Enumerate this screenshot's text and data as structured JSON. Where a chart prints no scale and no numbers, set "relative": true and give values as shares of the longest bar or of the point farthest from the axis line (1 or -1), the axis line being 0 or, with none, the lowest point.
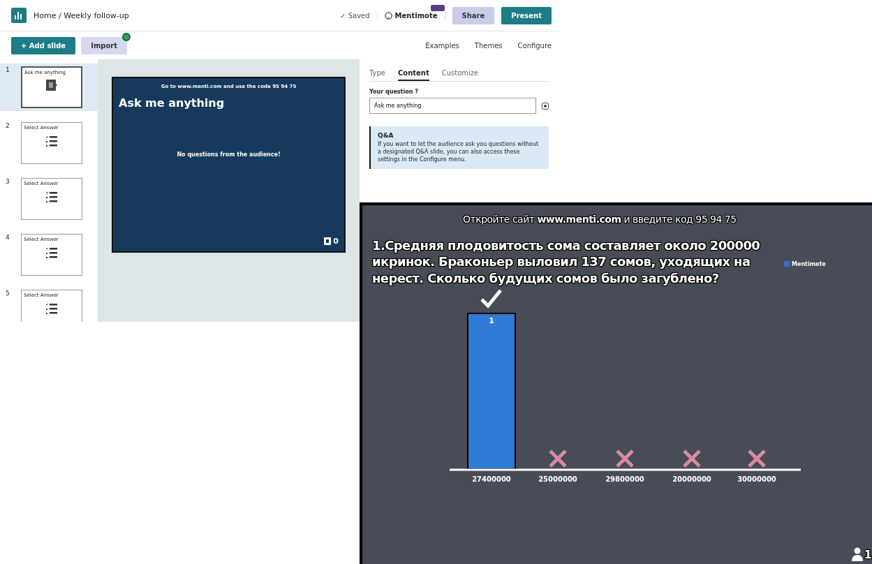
{
  "editor": {
    "breadcrumb": "Home / Weekly follow-up",
    "saved": "✓ Saved",
    "help_label": "Mentimote",
    "share": "Share",
    "present": "Present",
    "add_slide": "+ Add slide",
    "import": "Import",
    "toolbar_links": [
      "Examples",
      "Themes",
      "Configure"
    ],
    "slides": [
      {
        "number": "1",
        "title": "Ask me anything",
        "kind": "qa",
        "selected": true
      },
      {
        "number": "2",
        "title": "Select Answer",
        "kind": "choice",
        "selected": false
      },
      {
        "number": "3",
        "title": "Select Answer",
        "kind": "choice",
        "selected": false
      },
      {
        "number": "4",
        "title": "Select Answer",
        "kind": "choice",
        "selected": false
      },
      {
        "number": "5",
        "title": "Select Answer",
        "kind": "choice",
        "selected": false
      }
    ],
    "preview": {
      "join_text": "Go to www.menti.com and use the code 95 94 75",
      "title": "Ask me anything",
      "empty_text": "No questions from the audience!",
      "count": "0"
    },
    "tabs": [
      {
        "label": "Type",
        "selected": false
      },
      {
        "label": "Content",
        "selected": true
      },
      {
        "label": "Customize",
        "selected": false
      }
    ],
    "question_label": "Your question ?",
    "question_value": "Ask me anything",
    "info": {
      "title": "Q&A",
      "text": "If you want to let the audience ask you questions without a designated Q&A slide, you can also access these settings in the Configure menu."
    }
  },
  "presentation": {
    "join_text": "Откройте сайт **www.menti.com** и введите код 95 94 75",
    "logo": "Mentimete",
    "question": "1.Средняя плодовитость сома составляет около 200000 икринок. Браконьер выловил 137 сомов, уходящих на нерест. Сколько будущих сомов было загублено?",
    "participants": "1",
    "chart_data": {
      "type": "bar",
      "categories": [
        "27400000",
        "25000000",
        "29800000",
        "20000000",
        "30000000"
      ],
      "series": [
        {
          "color": "#2f7bd6",
          "values": [
            1,
            0,
            0,
            0,
            0
          ]
        }
      ],
      "relative": true,
      "value_labels": [
        "1",
        null,
        null,
        null,
        null
      ]
    },
    "correct": [
      true,
      false,
      false,
      false,
      false
    ]
  }
}
